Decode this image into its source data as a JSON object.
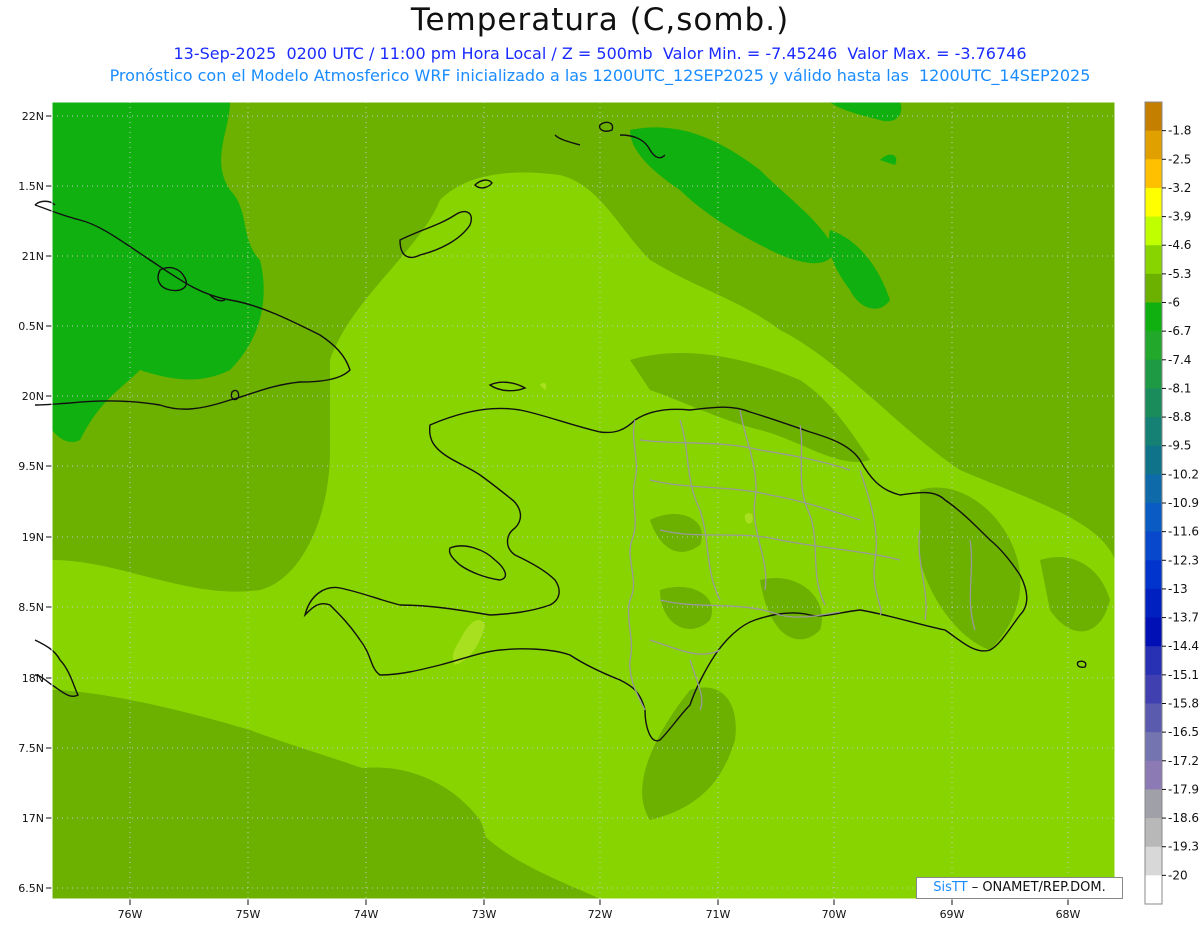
{
  "title": "Temperatura (C,somb.)",
  "subtitle_line1": "13-Sep-2025  0200 UTC / 11:00 pm Hora Local / Z = 500mb  Valor Min. = -7.45246  Valor Max. = -3.76746",
  "subtitle_line2": "Pronóstico con el Modelo Atmosferico WRF inicializado a las 1200UTC_12SEP2025 y válido hasta las  1200UTC_14SEP2025",
  "lat_labels": [
    "22N",
    "1.5N",
    "21N",
    "0.5N",
    "20N",
    "9.5N",
    "19N",
    "8.5N",
    "18N",
    "7.5N",
    "17N",
    "6.5N"
  ],
  "lon_labels": [
    "76W",
    "75W",
    "74W",
    "73W",
    "72W",
    "71W",
    "70W",
    "69W",
    "68W"
  ],
  "colorbar": {
    "labels": [
      "-1.8",
      "-2.5",
      "-3.2",
      "-3.9",
      "-4.6",
      "-5.3",
      "-6",
      "-6.7",
      "-7.4",
      "-8.1",
      "-8.8",
      "-9.5",
      "-10.2",
      "-10.9",
      "-11.6",
      "-12.3",
      "-13",
      "-13.7",
      "-14.4",
      "-15.1",
      "-15.8",
      "-16.5",
      "-17.2",
      "-17.9",
      "-18.6",
      "-19.3",
      "-20"
    ],
    "colors": [
      "#c47f00",
      "#e0a000",
      "#ffc000",
      "#ffff00",
      "#c0ff00",
      "#88d400",
      "#6cb000",
      "#10b010",
      "#22a82a",
      "#1f9a44",
      "#1a8c5c",
      "#158074",
      "#0f748a",
      "#0e6aa8",
      "#0a5cc4",
      "#0848cc",
      "#0034cc",
      "#0020c0",
      "#0010b4",
      "#2830b4",
      "#4040b0",
      "#5a5aae",
      "#7474b0",
      "#8c7ab4",
      "#a0a0a8",
      "#b8b8b8",
      "#d8d8d8",
      "#ffffff"
    ]
  },
  "field_colors": {
    "dark": "#6cb000",
    "mid": "#88d400",
    "light": "#a8e020",
    "cold": "#10b010",
    "colder": "#22a82a"
  },
  "credit_brand": "SisTT",
  "credit_text": " – ONAMET/REP.DOM."
}
